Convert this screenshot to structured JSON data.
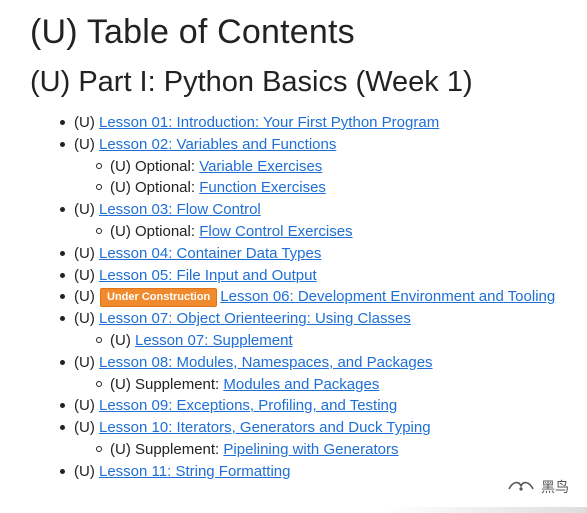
{
  "title": "(U) Table of Contents",
  "part_heading": "(U) Part I: Python Basics (Week 1)",
  "badge_label": "Under Construction",
  "items": [
    {
      "prefix": "(U)",
      "link": "Lesson 01: Introduction: Your First Python Program",
      "subs": []
    },
    {
      "prefix": "(U)",
      "link": "Lesson 02: Variables and Functions",
      "subs": [
        {
          "prefix": "(U) Optional:",
          "link": "Variable Exercises"
        },
        {
          "prefix": "(U) Optional:",
          "link": "Function Exercises"
        }
      ]
    },
    {
      "prefix": "(U)",
      "link": "Lesson 03: Flow Control",
      "subs": [
        {
          "prefix": "(U) Optional:",
          "link": "Flow Control Exercises"
        }
      ]
    },
    {
      "prefix": "(U)",
      "link": "Lesson 04: Container Data Types",
      "subs": []
    },
    {
      "prefix": "(U)",
      "link": "Lesson 05: File Input and Output",
      "subs": []
    },
    {
      "prefix": "(U)",
      "badge": true,
      "link": "Lesson 06: Development Environment and Tooling",
      "subs": []
    },
    {
      "prefix": "(U)",
      "link": "Lesson 07: Object Orienteering: Using Classes",
      "subs": [
        {
          "prefix": "(U)",
          "link": "Lesson 07: Supplement"
        }
      ]
    },
    {
      "prefix": "(U)",
      "link": "Lesson 08: Modules, Namespaces, and Packages",
      "subs": [
        {
          "prefix": "(U) Supplement:",
          "link": "Modules and Packages"
        }
      ]
    },
    {
      "prefix": "(U)",
      "link": "Lesson 09: Exceptions, Profiling, and Testing",
      "subs": []
    },
    {
      "prefix": "(U)",
      "link": "Lesson 10: Iterators, Generators and Duck Typing",
      "subs": [
        {
          "prefix": "(U) Supplement:",
          "link": "Pipelining with Generators"
        }
      ]
    },
    {
      "prefix": "(U)",
      "link": "Lesson 11: String Formatting",
      "subs": []
    }
  ],
  "watermark_text": "黑鸟",
  "colors": {
    "link": "#1f6fd6",
    "badge": "#f08a2c",
    "text": "#222222"
  }
}
